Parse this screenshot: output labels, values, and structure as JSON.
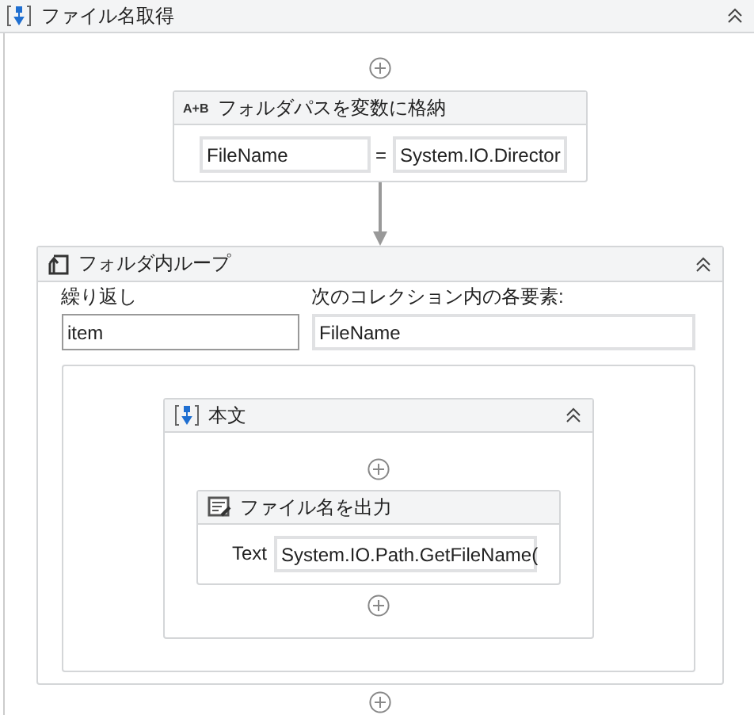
{
  "sequence": {
    "title": "ファイル名取得"
  },
  "assign": {
    "icon_label": "A+B",
    "title": "フォルダパスを変数に格納",
    "to": "FileName",
    "operator": "=",
    "value": "System.IO.Director"
  },
  "loop": {
    "title": "フォルダ内ループ",
    "fields": [
      {
        "label": "繰り返し",
        "value": "item"
      },
      {
        "label": "次のコレクション内の各要素:",
        "value": "FileName"
      }
    ]
  },
  "body": {
    "title": "本文"
  },
  "write_line": {
    "title": "ファイル名を出力",
    "label": "Text",
    "value": "System.IO.Path.GetFileName("
  }
}
